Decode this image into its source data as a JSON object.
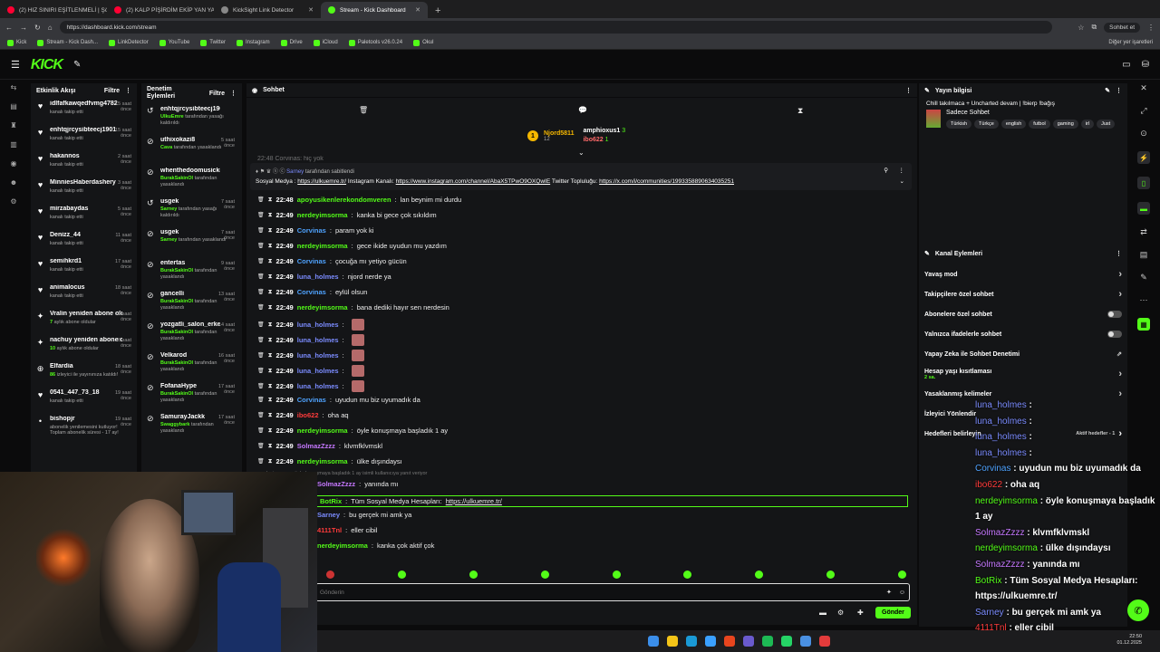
{
  "browser": {
    "tabs": [
      {
        "label": "(2) HIZ SINIRI EŞİTLENMELİ | Şöhret",
        "color": "#ff0033"
      },
      {
        "label": "(2) KALP PİŞİRDİM EKİP YAN YATTI",
        "color": "#ff0033"
      },
      {
        "label": "KickSight Link Detector",
        "color": "#888888"
      },
      {
        "label": "Stream - Kick Dashboard",
        "color": "#53fc18"
      }
    ],
    "url": "https://dashboard.kick.com/stream",
    "profile": "Sohbet et",
    "bookmarks": [
      "Kick",
      "Stream - Kick Dash...",
      "LinkDetector",
      "YouTube",
      "Twitter",
      "Instagram",
      "Drive",
      "iCloud",
      "Paletools v26.0.24",
      "Okul"
    ],
    "other_bookmarks": "Diğer yer işaretleri"
  },
  "kick": {
    "logo": "KICK"
  },
  "activity": {
    "title": "Etkinlik Akışı",
    "filter": "Filtre",
    "items": [
      {
        "name": "idlfafkawqedfvmg4782",
        "sub": "kanalı takip etti",
        "time": "15 saat önce",
        "icon": "heart"
      },
      {
        "name": "enhtqjrcysibteecj1901",
        "sub": "kanalı takip etti",
        "time": "15 saat önce",
        "icon": "heart"
      },
      {
        "name": "hakannos",
        "sub": "kanalı takip etti",
        "time": "2 saat önce",
        "icon": "heart"
      },
      {
        "name": "MinniesHaberdashery",
        "sub": "kanalı takip etti",
        "time": "3 saat önce",
        "icon": "heart"
      },
      {
        "name": "mirzabaydas",
        "sub": "kanalı takip etti",
        "time": "5 saat önce",
        "icon": "heart"
      },
      {
        "name": "Denizz_44",
        "sub": "kanalı takip etti",
        "time": "11 saat önce",
        "icon": "heart"
      },
      {
        "name": "semihkrd1",
        "sub": "kanalı takip etti",
        "time": "17 saat önce",
        "icon": "heart"
      },
      {
        "name": "animalocus",
        "sub": "kanalı takip etti",
        "time": "18 saat önce",
        "icon": "heart"
      },
      {
        "name": "Vralin yeniden abone oldu!",
        "sub": "aylık abone oldular",
        "hl": "7",
        "time": "18 saat önce",
        "icon": "star"
      },
      {
        "name": "nachuy yeniden abone oldu!",
        "sub": "aylık abone oldular",
        "hl": "10",
        "time": "18 saat önce",
        "icon": "star"
      },
      {
        "name": "Elfardia",
        "sub": "izleyici ile yayınınıza katıldı!",
        "hl": "86",
        "time": "18 saat önce",
        "icon": "raid"
      },
      {
        "name": "0541_447_73_18",
        "sub": "kanalı takip etti",
        "time": "19 saat önce",
        "icon": "heart"
      },
      {
        "name": "bishopjr",
        "sub": "abonelik yenilemesini kutluyor! Toplam abonelik süresi - 17 ay!",
        "time": "19 saat önce",
        "icon": "dot"
      }
    ]
  },
  "moderation": {
    "title": "Denetim Eylemleri",
    "filter": "Filtre",
    "items": [
      {
        "name": "enhtqjrcysibteecj1901",
        "by": "UlkuEmre",
        "sub": "tarafından yasağı kaldırıldı",
        "time": "",
        "icon": "undo"
      },
      {
        "name": "uthixokazi8",
        "by": "Cava",
        "sub": "tarafından yasaklandı",
        "time": "5 saat önce",
        "icon": "ban"
      },
      {
        "name": "whenthedoomusickicl",
        "by": "BurakSakinOl",
        "sub": "tarafından yasaklandı",
        "time": "",
        "icon": "ban"
      },
      {
        "name": "usgek",
        "by": "Sarney",
        "sub": "tarafından yasağı kaldırıldı",
        "time": "7 saat önce",
        "icon": "undo"
      },
      {
        "name": "usgek",
        "by": "Sarney",
        "sub": "tarafından yasaklandı",
        "time": "7 saat önce",
        "icon": "ban"
      },
      {
        "name": "entertas",
        "by": "BurakSakinOl",
        "sub": "tarafından yasaklandı",
        "time": "9 saat önce",
        "icon": "ban"
      },
      {
        "name": "gancelli",
        "by": "BurakSakinOl",
        "sub": "tarafından yasaklandı",
        "time": "13 saat önce",
        "icon": "ban"
      },
      {
        "name": "yozgatli_salon_erkegi",
        "by": "BurakSakinOl",
        "sub": "tarafından yasaklandı",
        "time": "14 saat önce",
        "icon": "ban"
      },
      {
        "name": "Velkarod",
        "by": "BurakSakinOl",
        "sub": "tarafından yasaklandı",
        "time": "16 saat önce",
        "icon": "ban"
      },
      {
        "name": "FofanaHype",
        "by": "BurakSakinOl",
        "sub": "tarafından yasaklandı",
        "time": "17 saat önce",
        "icon": "ban"
      },
      {
        "name": "SamurayJackk",
        "by": "Swaggybark",
        "sub": "tarafından yasaklandı",
        "time": "17 saat önce",
        "icon": "ban"
      }
    ]
  },
  "chat": {
    "title": "Sohbet",
    "top_gifter": {
      "name": "Njord5811",
      "count": "12"
    },
    "leaders": [
      {
        "name": "amphioxus1",
        "count": "3"
      },
      {
        "name": "ibo622",
        "count": "1"
      }
    ],
    "faded_line": "22:48 Corvinas: hiç yok",
    "pinned": {
      "by": "Sarney",
      "by_suffix": "tarafından sabitlendi",
      "text_a": "Sosyal Medya : ",
      "link1": "https://ulkuemre.tr/",
      "text_b": " Instagram Kanalı: ",
      "link2": "https://www.instagram.com/channel/AbaX5TPwO9OXQwIE",
      "text_c": " Twitter Topluluğu: ",
      "link3": "https://x.com/i/communities/1993358890634035251"
    },
    "messages": [
      {
        "t": "22:48",
        "u": "apoyusikenlerekondomveren",
        "c": "#53fc18",
        "m": "lan beynim mi durdu"
      },
      {
        "t": "22:49",
        "u": "nerdeyimsorma",
        "c": "#53fc18",
        "m": "kanka bi gece çok sıkıldım"
      },
      {
        "t": "22:49",
        "u": "Corvinas",
        "c": "#4fa3ff",
        "m": "param yok ki"
      },
      {
        "t": "22:49",
        "u": "nerdeyimsorma",
        "c": "#53fc18",
        "m": "gece ikide uyudun mu yazdım"
      },
      {
        "t": "22:49",
        "u": "Corvinas",
        "c": "#4fa3ff",
        "m": "çocuğa mı yetiyo gücün"
      },
      {
        "t": "22:49",
        "u": "luna_holmes",
        "c": "#7b8cff",
        "m": "njord nerde ya"
      },
      {
        "t": "22:49",
        "u": "Corvinas",
        "c": "#4fa3ff",
        "m": "eylül olsun"
      },
      {
        "t": "22:49",
        "u": "nerdeyimsorma",
        "c": "#53fc18",
        "m": "bana dediki hayır sen nerdesin"
      },
      {
        "t": "22:49",
        "u": "luna_holmes",
        "c": "#7b8cff",
        "m": ""
      },
      {
        "t": "22:49",
        "u": "luna_holmes",
        "c": "#7b8cff",
        "m": ""
      },
      {
        "t": "22:49",
        "u": "luna_holmes",
        "c": "#7b8cff",
        "m": ""
      },
      {
        "t": "22:49",
        "u": "luna_holmes",
        "c": "#7b8cff",
        "m": ""
      },
      {
        "t": "22:49",
        "u": "luna_holmes",
        "c": "#7b8cff",
        "m": ""
      },
      {
        "t": "22:49",
        "u": "Corvinas",
        "c": "#4fa3ff",
        "m": "uyudun mu biz uyumadık da"
      },
      {
        "t": "22:49",
        "u": "ibo622",
        "c": "#ff3b3b",
        "m": "oha aq"
      },
      {
        "t": "22:49",
        "u": "nerdeyimsorma",
        "c": "#53fc18",
        "m": "öyle konuşmaya başladık 1 ay"
      },
      {
        "t": "22:49",
        "u": "SolmazZzzz",
        "c": "#c678ff",
        "m": "klvmfklvmskl"
      },
      {
        "t": "22:49",
        "u": "nerdeyimsorma",
        "c": "#53fc18",
        "m": "ülke dışındaysı"
      }
    ],
    "reply_hint": "nerdeyimsorma: öyle konuşmaya başladık 1 ay isimli kullanıcıya yanıt veriyor",
    "lower": [
      {
        "u": "SolmazZzzz",
        "c": "#c678ff",
        "m": "yanında mı"
      },
      {
        "u": "BotRix",
        "c": "#53fc18",
        "m": "Tüm Sosyal Medya Hesapları:",
        "link": "https://ulkuemre.tr/"
      },
      {
        "u": "Sarney",
        "c": "#7b8cff",
        "m": "bu gerçek mi amk ya"
      },
      {
        "u": "4111Tnl",
        "c": "#ff3b3b",
        "m": "eller cibil"
      },
      {
        "u": "nerdeyimsorma",
        "c": "#53fc18",
        "m": "kanka çok aktif çok"
      }
    ],
    "input_placeholder": "Gönderin",
    "send": "Gönder"
  },
  "stream_info": {
    "title": "Yayın bilgisi",
    "stream_title": "Chill takılmaca + Uncharted devam | !bierp !bağış",
    "category": "Sadece Sohbet",
    "tags": [
      "Türkish",
      "Türkçe",
      "english",
      "futbol",
      "gaming",
      "irl",
      "Just"
    ]
  },
  "channel_actions": {
    "title": "Kanal Eylemleri",
    "options": [
      {
        "label": "Yavaş mod",
        "kind": "arrow"
      },
      {
        "label": "Takipçilere özel sohbet",
        "kind": "arrow"
      },
      {
        "label": "Abonelere özel sohbet",
        "kind": "toggle"
      },
      {
        "label": "Yalnızca ifadelerle sohbet",
        "kind": "toggle"
      },
      {
        "label": "Yapay Zeka ile Sohbet Denetimi",
        "kind": "ext"
      },
      {
        "label": "Hesap yaşı kısıtlaması",
        "sub": "2 sa.",
        "kind": "arrow"
      },
      {
        "label": "Yasaklanmış kelimeler",
        "kind": "arrow"
      },
      {
        "label": "İzleyici Yönlendir",
        "kind": "none"
      },
      {
        "label": "Hedefleri belirleyin",
        "kind": "goal",
        "goal": "Aktif hedefler - 1"
      }
    ]
  },
  "overlay": [
    {
      "u": "luna_holmes",
      "c": "#7b8cff",
      "m": ":"
    },
    {
      "u": "luna_holmes",
      "c": "#7b8cff",
      "m": ":"
    },
    {
      "u": "luna_holmes",
      "c": "#7b8cff",
      "m": ":"
    },
    {
      "u": "luna_holmes",
      "c": "#7b8cff",
      "m": ":"
    },
    {
      "u": "Corvinas",
      "c": "#4fa3ff",
      "m": ": uyudun mu biz uyumadık da"
    },
    {
      "u": "ibo622",
      "c": "#ff3b3b",
      "m": ": oha aq"
    },
    {
      "u": "nerdeyimsorma",
      "c": "#53fc18",
      "m": ": öyle konuşmaya başladık"
    },
    {
      "u": "",
      "c": "#fff",
      "m": "1 ay"
    },
    {
      "u": "SolmazZzzz",
      "c": "#c678ff",
      "m": ": klvmfklvmskl"
    },
    {
      "u": "nerdeyimsorma",
      "c": "#53fc18",
      "m": ": ülke dışındaysı"
    },
    {
      "u": "SolmazZzzz",
      "c": "#c678ff",
      "m": ": yanında mı"
    },
    {
      "u": "BotRix",
      "c": "#53fc18",
      "m": ": Tüm Sosyal Medya Hesapları:"
    },
    {
      "u": "",
      "c": "#fff",
      "m": "https://ulkuemre.tr/"
    },
    {
      "u": "Sarney",
      "c": "#7b8cff",
      "m": ": bu gerçek mi amk ya"
    },
    {
      "u": "4111Tnl",
      "c": "#ff3b3b",
      "m": ": eller cibil"
    },
    {
      "u": "nerdeyimsorma",
      "c": "#53fc18",
      "m": ": kanka çok aktif çok"
    }
  ],
  "clock": {
    "time": "22:50",
    "date": "01.12.2025"
  }
}
